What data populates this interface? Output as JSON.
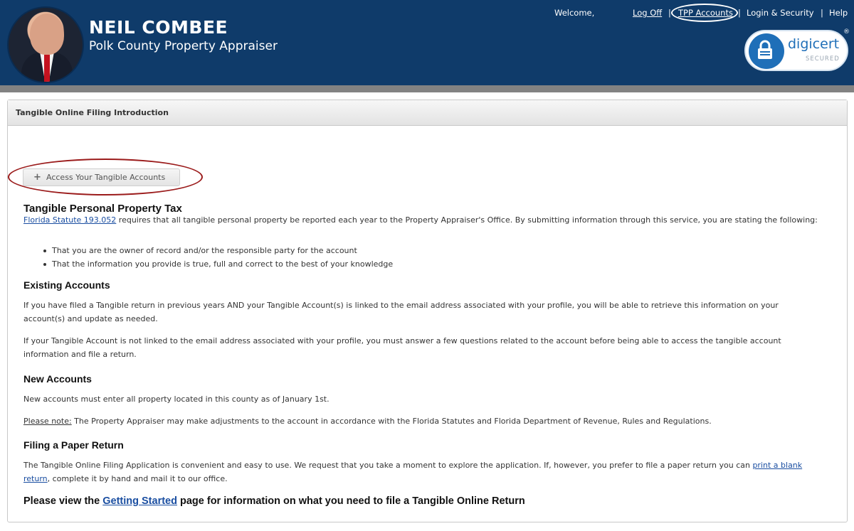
{
  "header": {
    "name": "NEIL COMBEE",
    "subtitle": "Polk County Property Appraiser",
    "welcome": "Welcome,",
    "log_off": "Log Off",
    "separator": "|",
    "tpp_accounts": "TPP Accounts",
    "login_security": "Login & Security",
    "help": "Help",
    "badge": {
      "brand": "digicert",
      "sub": "SECURED",
      "reg": "®"
    }
  },
  "panel": {
    "title": "Tangible Online Filing Introduction",
    "access_button": {
      "icon": "+",
      "label": "Access Your Tangible Accounts"
    }
  },
  "content": {
    "main_heading": "Tangible Personal Property Tax",
    "statute_link": "Florida Statute 193.052",
    "statute_text": " requires that all tangible personal property be reported each year to the Property Appraiser's Office. By submitting information through this service, you are stating the following:",
    "bullets": [
      "That you are the owner of record and/or the responsible party for the account",
      "That the information you provide is true, full and correct to the best of your knowledge"
    ],
    "existing_heading": "Existing Accounts",
    "existing_p1": "If you have filed a Tangible return in previous years AND your Tangible Account(s) is linked to the email address associated with your profile, you will be able to retrieve this information on your account(s) and update as needed.",
    "existing_p2": "If your Tangible Account is not linked to the email address associated with your profile, you must answer a few questions related to the account before being able to access the tangible account information and file a return.",
    "new_heading": "New Accounts",
    "new_p1": "New accounts must enter all property located in this county as of January 1st.",
    "note_label": "Please note:",
    "note_text": " The Property Appraiser may make adjustments to the account in accordance with the Florida Statutes and Florida Department of Revenue, Rules and Regulations.",
    "paper_heading": "Filing a Paper Return",
    "paper_text_before": "The Tangible Online Filing Application is convenient and easy to use. We request that you take a moment to explore the application. If, however, you prefer to file a paper return you can ",
    "paper_link": "print a blank return",
    "paper_text_after": ", complete it by hand and mail it to our office.",
    "final_before": "Please view the ",
    "final_link": "Getting Started",
    "final_after": " page for information on what you need to file a Tangible Online Return"
  },
  "colors": {
    "header_bg": "#0f3b6a",
    "annotation_ring": "#9b1b1b",
    "link": "#1a4ea1"
  },
  "icons": [
    "avatar-photo",
    "plus-icon",
    "lock-icon"
  ]
}
